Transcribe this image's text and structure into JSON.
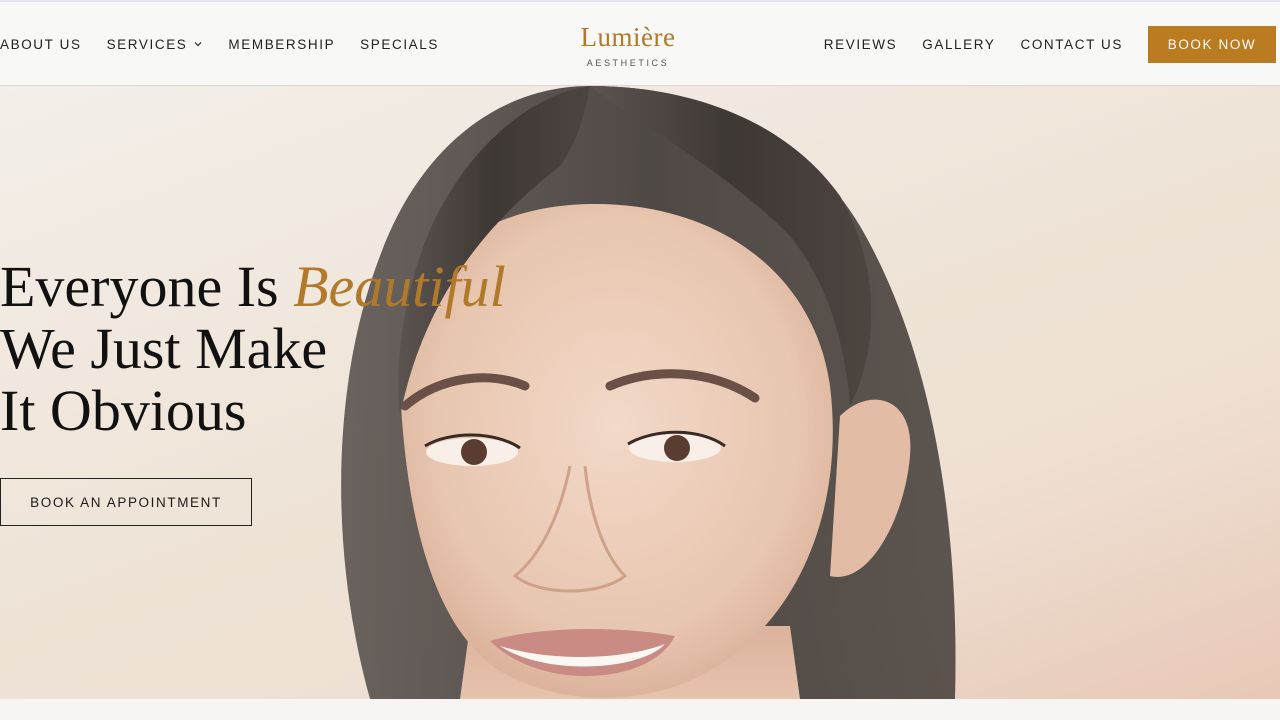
{
  "header": {
    "nav_left": [
      {
        "label": "ABOUT US"
      },
      {
        "label": "SERVICES",
        "has_dropdown": true
      },
      {
        "label": "MEMBERSHIP"
      },
      {
        "label": "SPECIALS"
      }
    ],
    "nav_right": [
      {
        "label": "REVIEWS"
      },
      {
        "label": "GALLERY"
      },
      {
        "label": "CONTACT US"
      }
    ],
    "book_now_label": "BOOK NOW",
    "logo": {
      "name": "Lumière",
      "tagline": "AESTHETICS"
    }
  },
  "hero": {
    "headline_line1": "Everyone Is ",
    "headline_accent": "Beautiful",
    "headline_line2": "We Just Make",
    "headline_line3": "It Obvious",
    "cta_label": "BOOK AN APPOINTMENT"
  },
  "colors": {
    "accent": "#bb7b21",
    "logo": "#b07a2a",
    "text": "#111111"
  },
  "icons": {
    "services_dropdown": "chevron-down-icon",
    "hero_image": "portrait-photo"
  }
}
